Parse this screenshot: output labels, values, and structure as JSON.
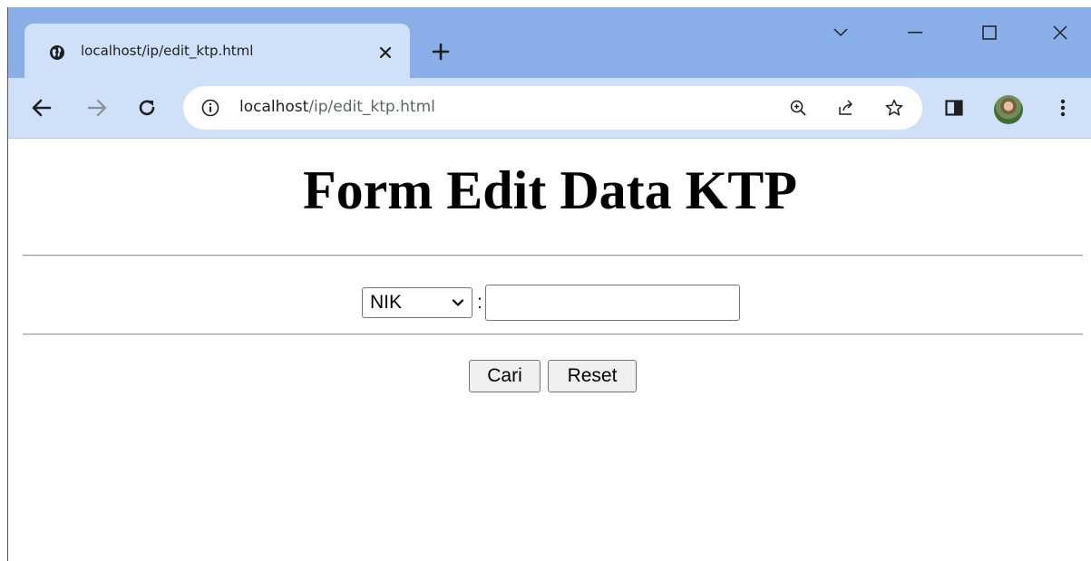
{
  "browser": {
    "tab": {
      "title": "localhost/ip/edit_ktp.html",
      "icon": "globe-icon"
    },
    "window_controls": [
      "chevron-down-icon",
      "minimize-icon",
      "maximize-icon",
      "close-icon"
    ],
    "address": {
      "host": "localhost",
      "path": "/ip/edit_ktp.html"
    },
    "toolbar_icons": [
      "back-icon",
      "forward-icon",
      "reload-icon",
      "info-icon",
      "zoom-icon",
      "share-icon",
      "star-icon",
      "side-panel-icon",
      "avatar",
      "menu-icon"
    ]
  },
  "page": {
    "title": "Form Edit Data KTP",
    "search": {
      "field_select_value": "NIK",
      "separator": ":",
      "input_value": ""
    },
    "buttons": {
      "search": "Cari",
      "reset": "Reset"
    }
  },
  "colors": {
    "tabbar": "#8aaee8",
    "toolbar": "#cfe0f9",
    "page_bg": "#ffffff"
  }
}
